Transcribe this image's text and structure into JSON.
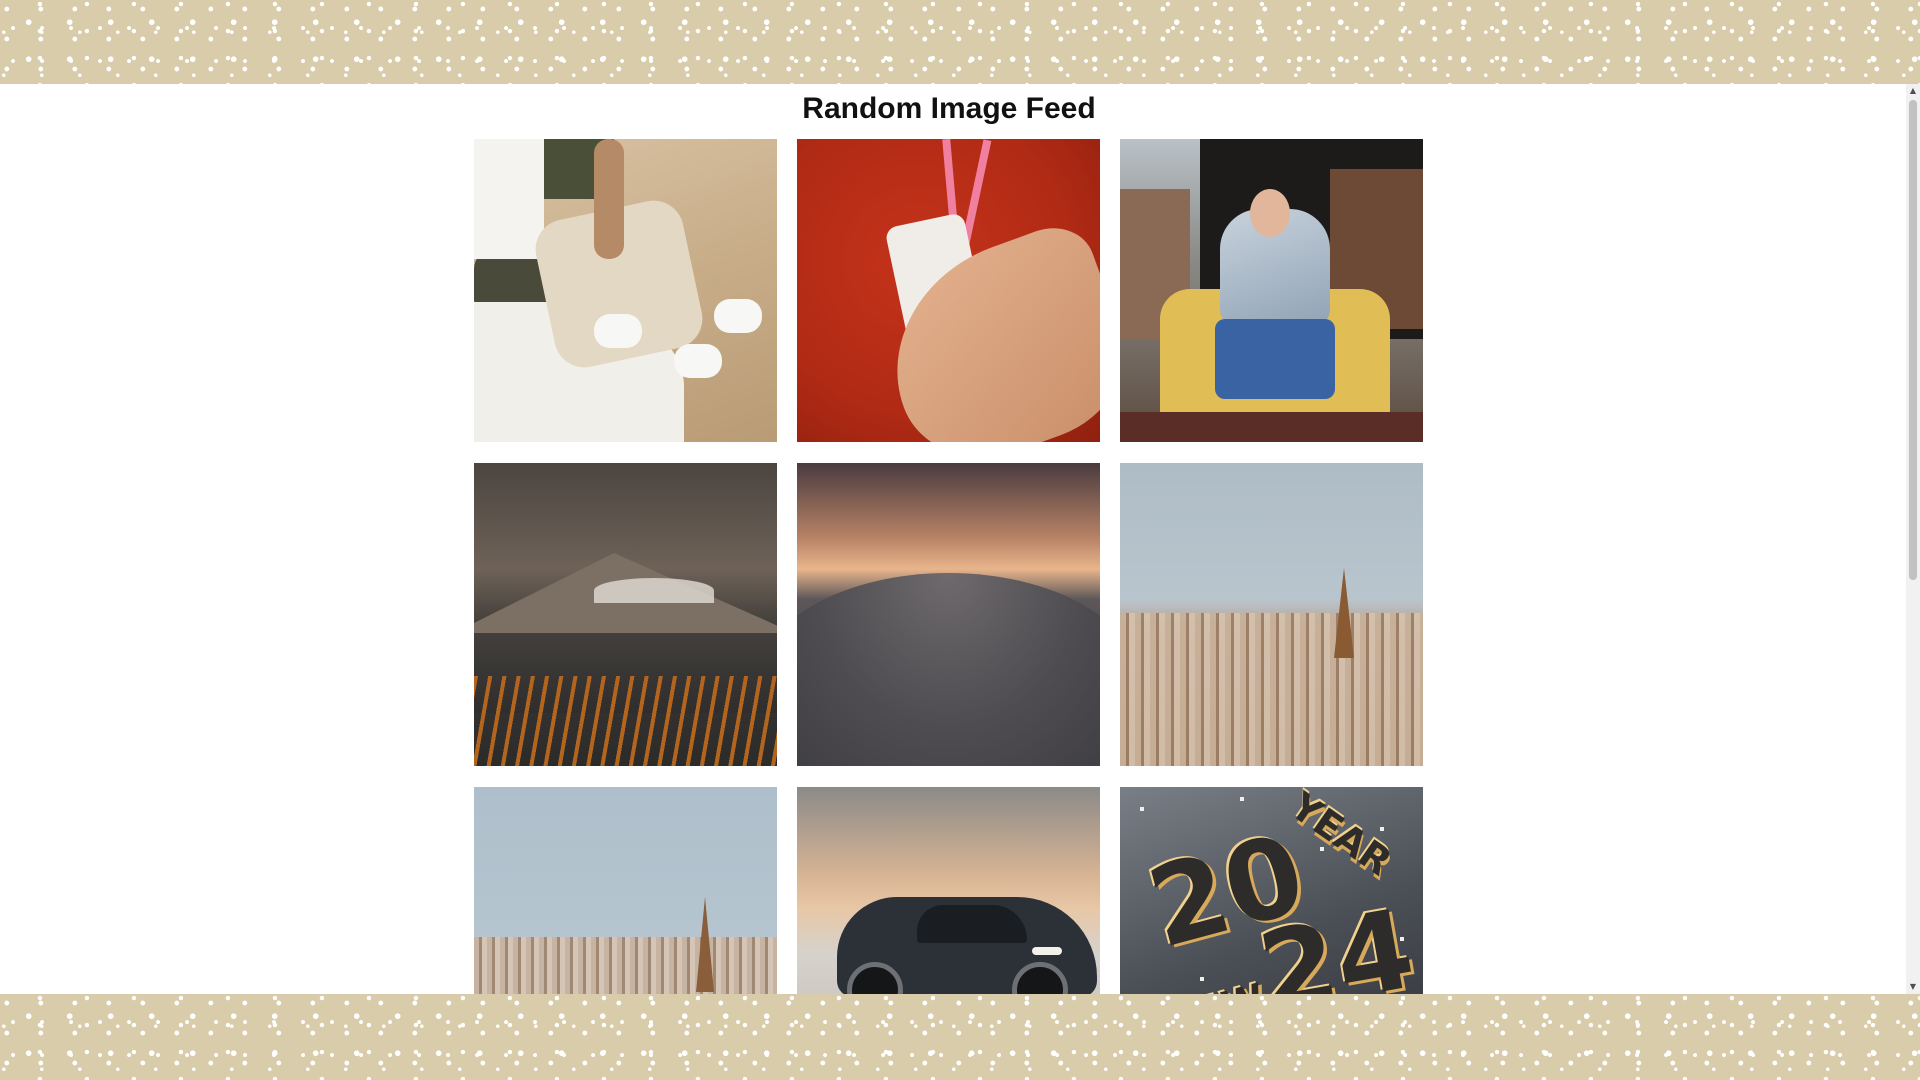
{
  "page": {
    "title": "Random Image Feed"
  },
  "feed": {
    "images": [
      {
        "name": "image-beach-couple"
      },
      {
        "name": "image-hand-drink-red"
      },
      {
        "name": "image-man-yellow-chair"
      },
      {
        "name": "image-mountain-lake"
      },
      {
        "name": "image-dune-sunset"
      },
      {
        "name": "image-paris-aerial"
      },
      {
        "name": "image-paris-skyline"
      },
      {
        "name": "image-suv-snow"
      },
      {
        "name": "image-new-year-2024"
      }
    ],
    "new_year_text": {
      "digits_top": "20",
      "digits_bottom": "24",
      "word_top": "YEAR",
      "word_bottom": "NEW"
    }
  },
  "scrollbar": {
    "up_arrow": "▲",
    "down_arrow": "▼"
  },
  "colors": {
    "border_pattern": "#d9ccaa",
    "page_background": "#ffffff",
    "title_text": "#111111"
  }
}
